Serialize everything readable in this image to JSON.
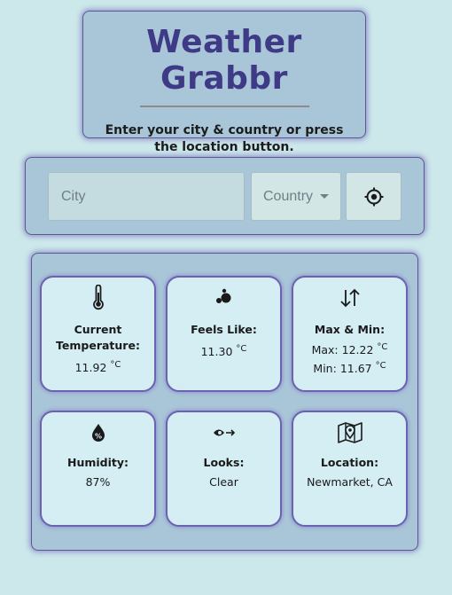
{
  "header": {
    "title": "Weather Grabbr",
    "subtitle_part1": "Enter your city & country ",
    "subtitle_or": "or",
    "subtitle_part2": " press the location button."
  },
  "search": {
    "city_placeholder": "City",
    "city_value": "",
    "country_label": "Country"
  },
  "cards": {
    "temperature": {
      "icon": "thermometer-icon",
      "label_line1": "Current",
      "label_line2": "Temperature:",
      "value": "11.92",
      "unit": "°C"
    },
    "feels_like": {
      "icon": "bubbles-icon",
      "label": "Feels Like:",
      "value": "11.30",
      "unit": "°C"
    },
    "max_min": {
      "icon": "up-down-arrows-icon",
      "label": "Max & Min:",
      "max_label": "Max:",
      "max_value": "12.22",
      "min_label": "Min:",
      "min_value": "11.67",
      "unit": "°C"
    },
    "humidity": {
      "icon": "humidity-drop-icon",
      "label": "Humidity:",
      "value": "87%"
    },
    "looks": {
      "icon": "eye-arrow-icon",
      "label": "Looks:",
      "value": "Clear"
    },
    "location": {
      "icon": "map-pin-icon",
      "label": "Location:",
      "value": "Newmarket, CA"
    }
  },
  "colors": {
    "background": "#cce8ea",
    "panel": "#a9c6d8",
    "title": "#3f3a85",
    "card": "#d4eef4",
    "card_border": "#6b62b0"
  }
}
